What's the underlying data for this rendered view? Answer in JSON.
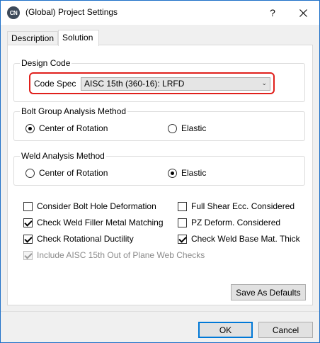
{
  "window": {
    "app_icon_text": "CN",
    "title": "(Global) Project Settings",
    "help_glyph": "?",
    "close_icon": "close-icon"
  },
  "tabs": [
    {
      "label": "Description",
      "active": false
    },
    {
      "label": "Solution",
      "active": true
    }
  ],
  "design_code": {
    "group_label": "Design Code",
    "code_spec_label": "Code Spec",
    "code_spec_value": "AISC 15th (360-16): LRFD",
    "highlight_color": "#e0201c"
  },
  "bolt_group": {
    "group_label": "Bolt Group Analysis Method",
    "options": [
      {
        "label": "Center of Rotation",
        "selected": true
      },
      {
        "label": "Elastic",
        "selected": false
      }
    ]
  },
  "weld_analysis": {
    "group_label": "Weld Analysis Method",
    "options": [
      {
        "label": "Center of Rotation",
        "selected": false
      },
      {
        "label": "Elastic",
        "selected": true
      }
    ]
  },
  "checkboxes": {
    "consider_bolt_hole": {
      "label": "Consider Bolt Hole Deformation",
      "checked": false
    },
    "full_shear_ecc": {
      "label": "Full Shear Ecc. Considered",
      "checked": false
    },
    "check_weld_filler": {
      "label": "Check Weld Filler Metal Matching",
      "checked": true
    },
    "pz_deform": {
      "label": "PZ Deform. Considered",
      "checked": false
    },
    "check_rotational": {
      "label": "Check Rotational Ductility",
      "checked": true
    },
    "check_weld_base": {
      "label": "Check Weld Base Mat. Thick",
      "checked": true
    },
    "include_aisc": {
      "label": "Include AISC 15th Out of Plane Web Checks",
      "checked": true,
      "disabled": true
    }
  },
  "buttons": {
    "save_defaults": "Save As Defaults",
    "ok": "OK",
    "cancel": "Cancel"
  },
  "colors": {
    "accent": "#0078d7",
    "window_border": "#1e70c8"
  }
}
